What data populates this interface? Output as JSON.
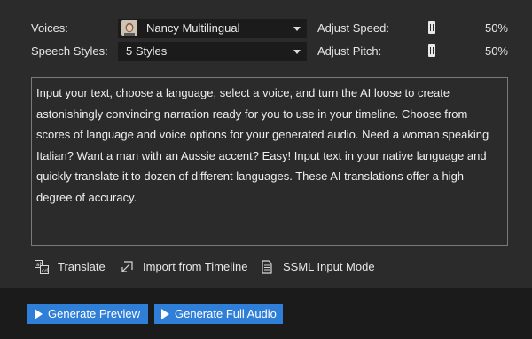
{
  "voices": {
    "label": "Voices:",
    "selected": "Nancy Multilingual",
    "avatar_icon": "voice-avatar"
  },
  "speech_styles": {
    "label": "Speech Styles:",
    "selected": "5 Styles"
  },
  "speed": {
    "label": "Adjust Speed:",
    "value_text": "50%",
    "value": 0.5
  },
  "pitch": {
    "label": "Adjust Pitch:",
    "value_text": "50%",
    "value": 0.5
  },
  "text_input": {
    "value": "Input your text, choose a language, select a voice, and turn the AI loose to create astonishingly convincing narration ready for you to use in your timeline. Choose from scores of language and voice options for your generated audio. Need a woman speaking Italian? Want a man with an Aussie accent? Easy! Input text in your native language and quickly translate it to dozen of different languages. These AI translations offer a high degree of accuracy."
  },
  "tools": {
    "translate": {
      "label": "Translate",
      "icon": "translate-icon"
    },
    "import": {
      "label": "Import from Timeline",
      "icon": "import-icon"
    },
    "ssml": {
      "label": "SSML Input Mode",
      "icon": "ssml-icon"
    }
  },
  "actions": {
    "preview": {
      "label": "Generate Preview",
      "icon": "play-icon"
    },
    "full": {
      "label": "Generate Full Audio",
      "icon": "play-icon"
    }
  },
  "colors": {
    "background": "#2b2b2b",
    "footer": "#1b1b1b",
    "accent": "#2f7fd8"
  }
}
